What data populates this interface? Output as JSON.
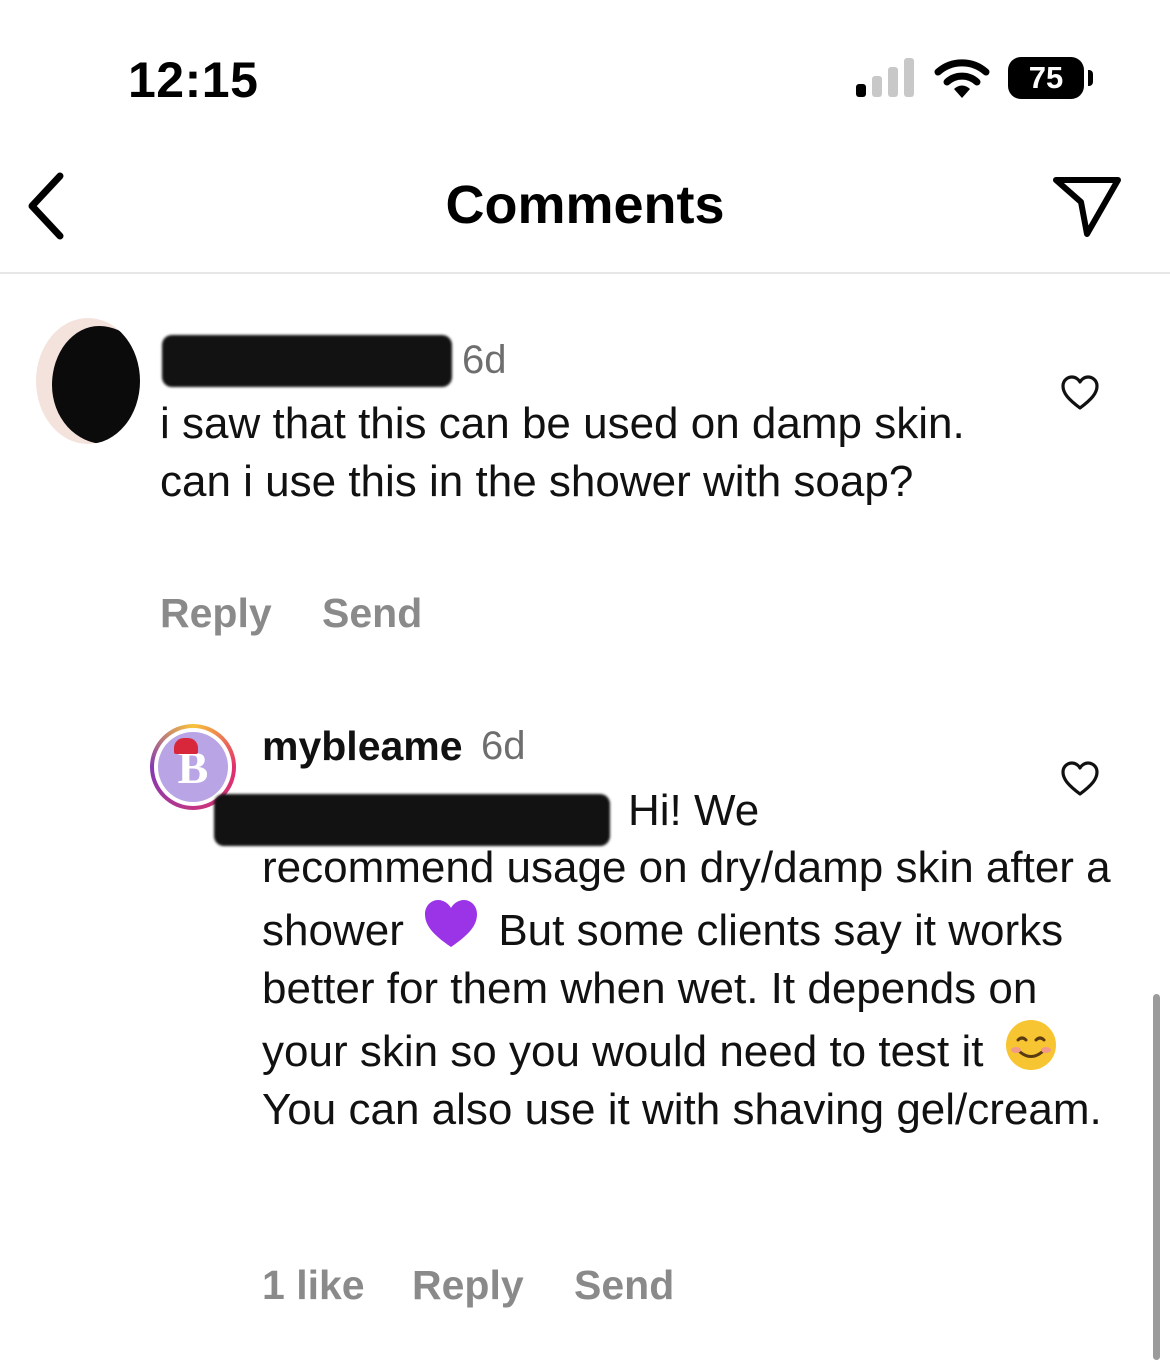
{
  "status_bar": {
    "time": "12:15",
    "battery": "75",
    "signal_icon": "cellular-signal-icon",
    "wifi_icon": "wifi-icon"
  },
  "nav": {
    "title": "Comments",
    "back_icon": "chevron-left-icon",
    "share_icon": "paper-plane-icon"
  },
  "comments": [
    {
      "username": "",
      "time": "6d",
      "text": "i saw that this can be used on damp skin. can i use this in the shower with soap?",
      "actions": {
        "reply": "Reply",
        "send": "Send"
      }
    },
    {
      "username": "mybleame",
      "time": "6d",
      "avatar_letter": "B",
      "line1": "Hi! We",
      "text_part1": "recommend usage on dry/damp skin after a shower",
      "emoji1": "purple-heart-emoji",
      "text_part2": "But some clients say it works better for them when wet. It depends on your skin so you would need to test it",
      "emoji2": "smiling-face-emoji",
      "text_part3": "You can also use it with shaving gel/cream.",
      "likes": "1 like",
      "actions": {
        "reply": "Reply",
        "send": "Send"
      }
    }
  ],
  "colors": {
    "secondary_text": "#8a8a8a",
    "timestamp": "#6e6e6e",
    "divider": "#e6e6e6",
    "avatar_brand": "#b9a4e6"
  }
}
